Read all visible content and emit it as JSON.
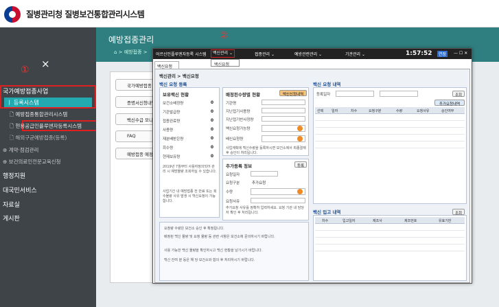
{
  "app": {
    "title": "질병관리청 질병보건통합관리시스템"
  },
  "annotations": {
    "one": "①",
    "two": "②"
  },
  "sidebar": {
    "close": "×",
    "items": [
      {
        "label": "국가예방접종사업"
      },
      {
        "label": "ㅣ 등록시스템"
      },
      {
        "label": "🗋 예방접종통합관리시스템"
      },
      {
        "label": "🗋 현용공급인플루엔자등록시스템"
      },
      {
        "label": "🗋 해외구균예방접종(등록)"
      },
      {
        "label": "⊕ 계약·점검관리"
      },
      {
        "label": "⊕ 보건의료인전문교육신청"
      },
      {
        "label": "행정지원"
      },
      {
        "label": "대국민서비스"
      },
      {
        "label": "자료실"
      },
      {
        "label": "게시판"
      }
    ]
  },
  "main": {
    "title": "예방접종관리",
    "breadcrumb": "⌂ > 예방접종 >"
  },
  "background": {
    "buttons": [
      "국가예방접종 지원",
      "증명서신청내역",
      "백신수급 모니",
      "FAQ",
      "예방접종 예정"
    ]
  },
  "window": {
    "title": "어르신인플루엔자등록 시스템",
    "menus": [
      "백신관리 ⌄",
      "접종관리 ⌄",
      "예방관련관리 ⌄",
      "기관관리 ⌄"
    ],
    "clock": "1:57:52",
    "badge": "연장",
    "controls": "— ☐ ✕",
    "popup_item": "백신요청",
    "tab": "백신요청 ✕",
    "breadcrumb": "백신관리 > 백신요청",
    "reg_title": "백신 요청 등록",
    "stock_title": "보유백신 현황",
    "stock_rows": [
      {
        "label": "보건소배정량",
        "value": "0"
      },
      {
        "label": "기관발급량",
        "value": "0"
      },
      {
        "label": "접종완료량",
        "value": "0"
      },
      {
        "label": "사용량",
        "value": "0"
      },
      {
        "label": "재분배받은량",
        "value": "0"
      },
      {
        "label": "회수량",
        "value": "0"
      },
      {
        "label": "현재보유량",
        "value": "0"
      }
    ],
    "stock_note": "2019년 7월부터 사용자정의되어 관리 시 예방물량 조회하실 수 있습니다.",
    "stock_note2": "사업기간 내 예방접종 전 만료 또는 회수물량 사유 발생 시 백신요청이 가능합니다.",
    "req_title": "배정된수량별 현황",
    "req_button": "백신신청내역",
    "req_rows": [
      "기관명",
      "지난접기사용량",
      "지난접기반사정량",
      "백신요청가능량",
      "배신요청량"
    ],
    "req_note": "사업계획에 백신수량을 등록하시면 보건소에서 최종결재 후 승인이 처리됩니다.",
    "add_title": "추가등록 정보",
    "add_button": "등록",
    "add_rows": [
      "요청일자",
      "요청구분",
      "수량",
      "요청사유"
    ],
    "add_radio": "추가요청",
    "add_note": "추가요청 사유를 정확히 입력하세요. 요청 기관 내 담당자 확인 후 처리됩니다.",
    "bottom_notes": [
      "요청량 수량은 보건소 승인 후 확정됩니다.",
      "배정된 백신 물량 및 요청 물량 등 관련 사항은 보건소에 문의하시기 바랍니다.",
      "사용 가능한 백신 물량을 확인하시고 백신 현황을 남기시기 바랍니다.",
      "백신 잔여 분 등은 해 당 보건소와 협의 후 처리하시기 바랍니다."
    ],
    "list_title": "백신 요청 내역",
    "search_label": "등록일자",
    "search_button": "조회",
    "list_button": "추가요청내역",
    "list_cols": [
      "선택",
      "일자",
      "차수",
      "요청구분",
      "수량",
      "요청사유",
      "승인여부"
    ],
    "recv_title": "백신 입고 내역",
    "recv_button": "조회",
    "recv_cols": [
      "차수",
      "입고일자",
      "제조사",
      "제조번호",
      "유효기한"
    ]
  }
}
